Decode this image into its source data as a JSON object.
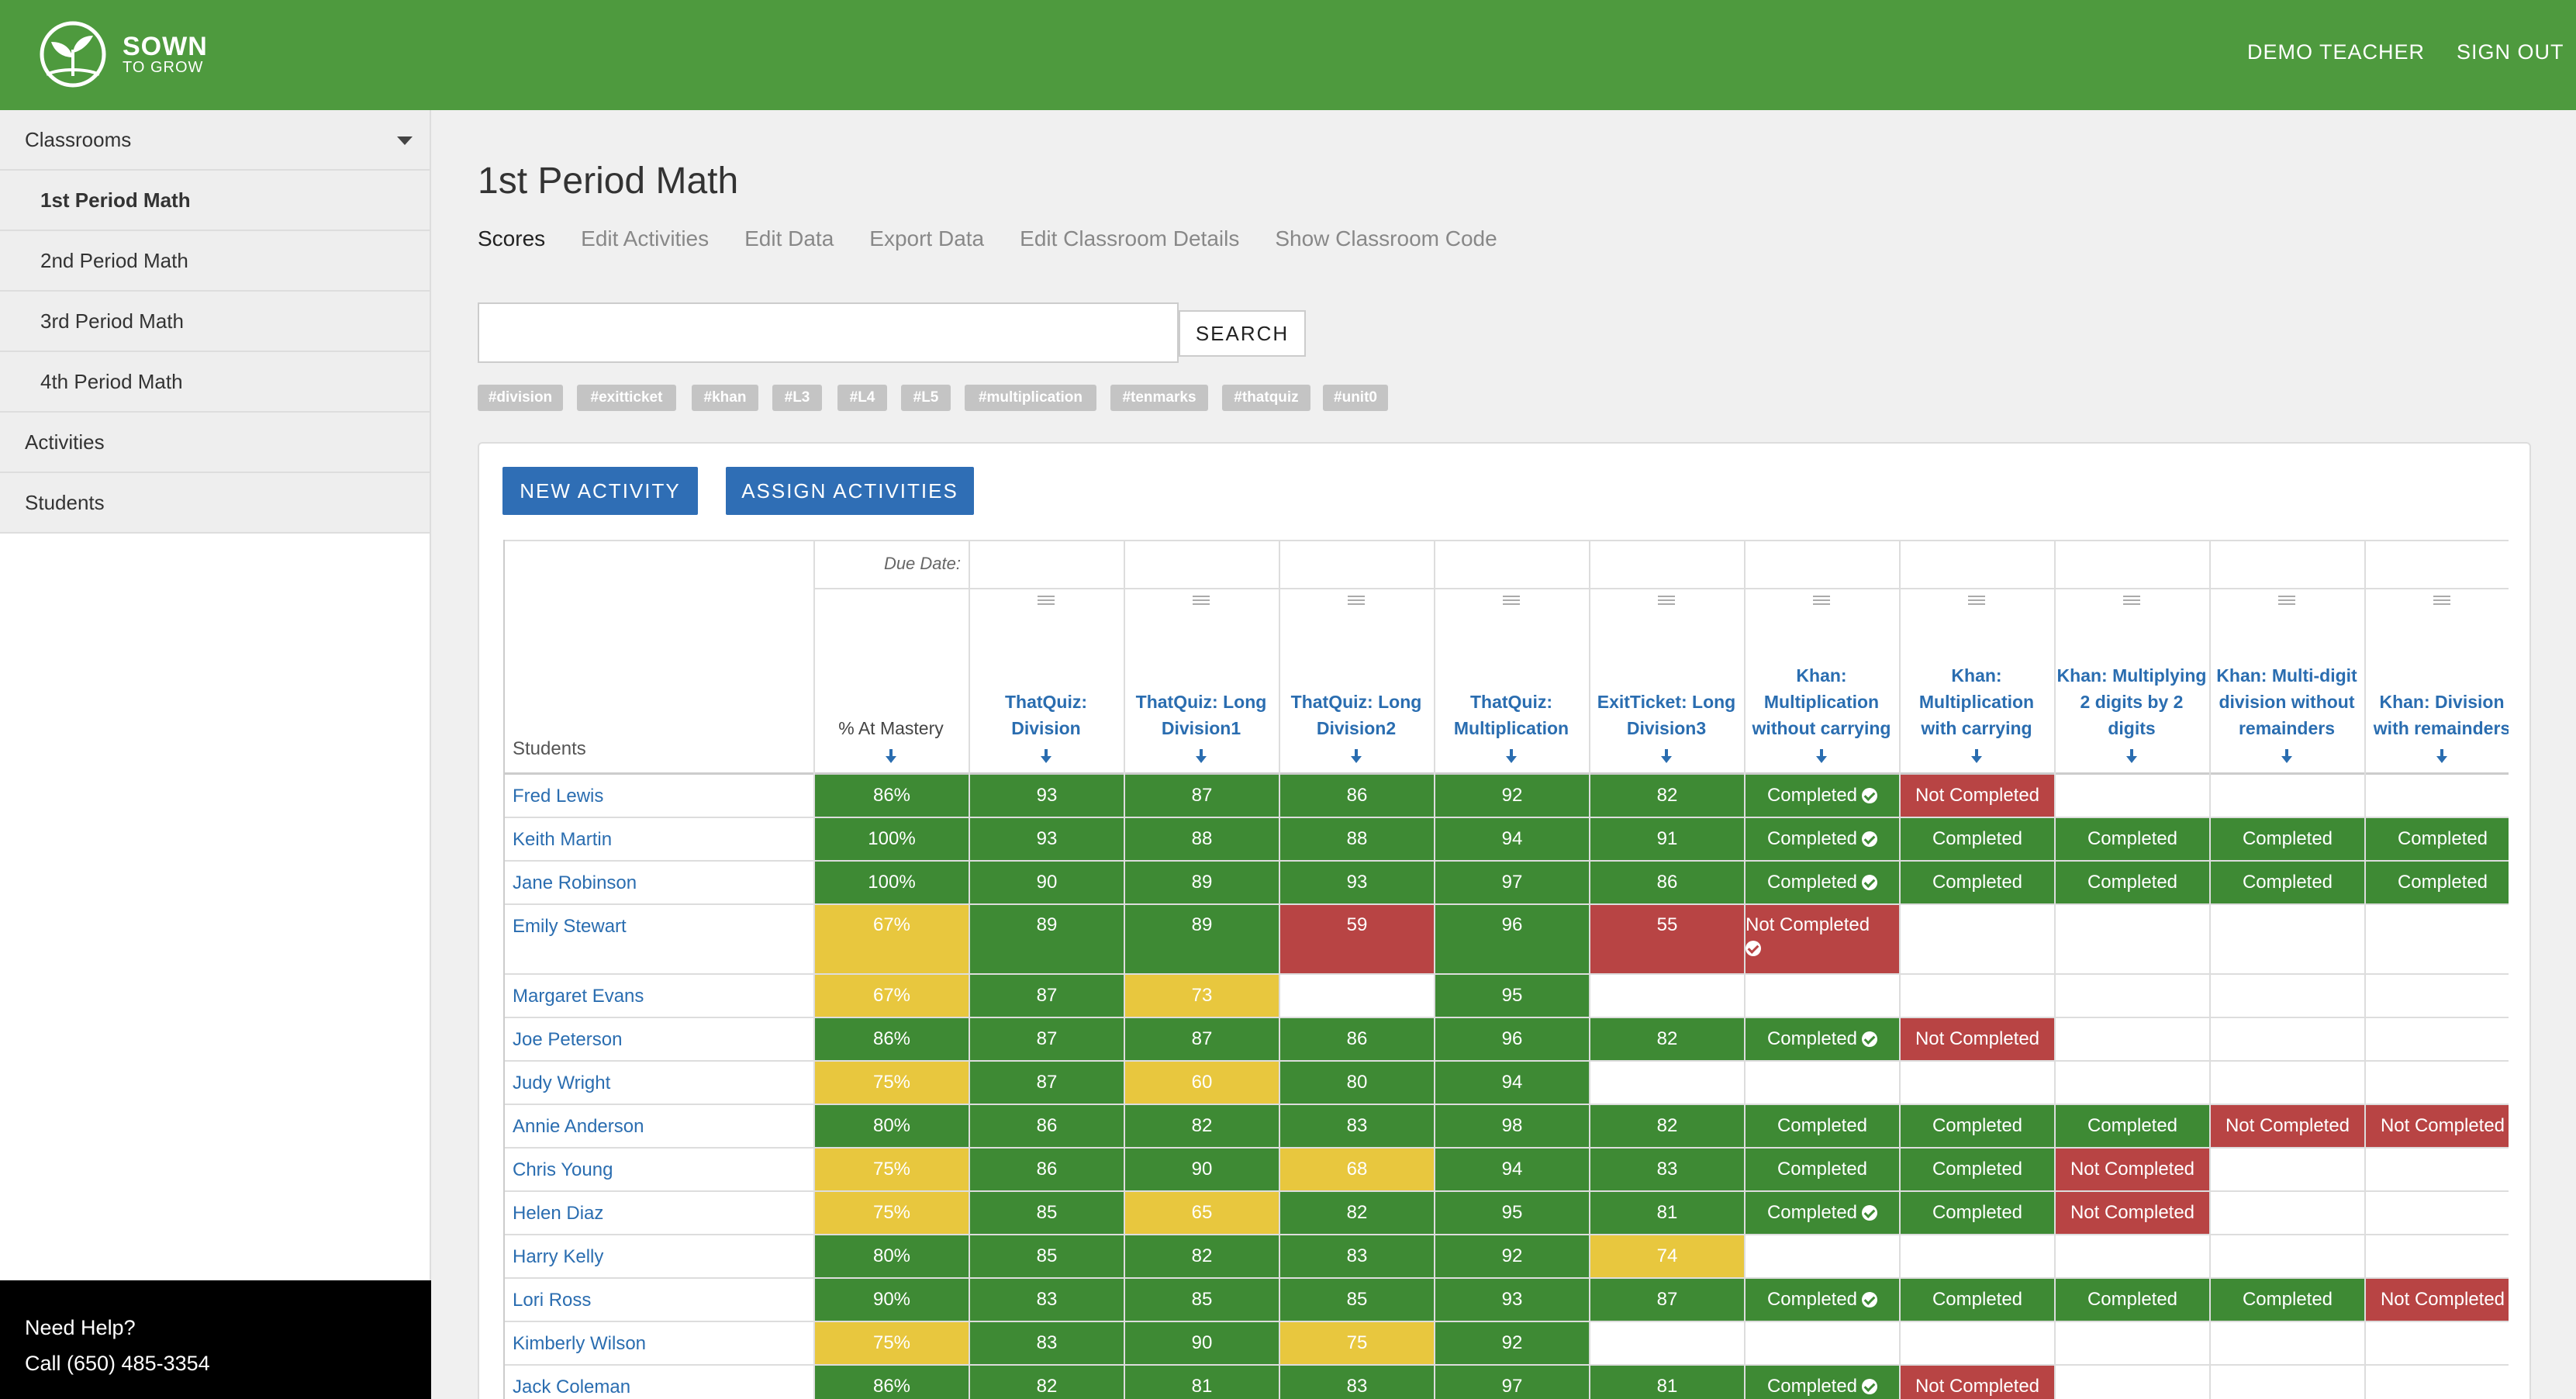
{
  "header": {
    "brand_line1": "SOWN",
    "brand_line2": "TO GROW",
    "user_label": "DEMO TEACHER",
    "signout_label": "SIGN OUT",
    "color": "#4e9a3e"
  },
  "sidebar": {
    "items": [
      {
        "label": "Classrooms",
        "level": "top",
        "expandable": true
      },
      {
        "label": "1st Period Math",
        "level": "sub",
        "selected": true
      },
      {
        "label": "2nd Period Math",
        "level": "sub"
      },
      {
        "label": "3rd Period Math",
        "level": "sub"
      },
      {
        "label": "4th Period Math",
        "level": "sub"
      },
      {
        "label": "Activities",
        "level": "top"
      },
      {
        "label": "Students",
        "level": "top"
      }
    ],
    "help_title": "Need Help?",
    "help_phone": "Call (650) 485-3354"
  },
  "main": {
    "title": "1st Period Math",
    "tabs": [
      "Scores",
      "Edit Activities",
      "Edit Data",
      "Export Data",
      "Edit Classroom Details",
      "Show Classroom Code"
    ],
    "active_tab": "Scores",
    "search": {
      "value": "",
      "placeholder": "",
      "button_label": "SEARCH"
    },
    "tags": [
      "#division",
      "#exitticket",
      "#khan",
      "#L3",
      "#L4",
      "#L5",
      "#multiplication",
      "#tenmarks",
      "#thatquiz",
      "#unit0"
    ],
    "new_activity_label": "NEW ACTIVITY",
    "assign_activities_label": "ASSIGN ACTIVITIES"
  },
  "table": {
    "due_date_label": "Due Date:",
    "students_header": "Students",
    "mastery_header": "% At Mastery",
    "columns": [
      "ThatQuiz: Division",
      "ThatQuiz: Long Division1",
      "ThatQuiz: Long Division2",
      "ThatQuiz: Multiplication",
      "ExitTicket: Long Division3",
      "Khan: Multiplication without carrying",
      "Khan: Multiplication with carrying",
      "Khan: Multiplying 2 digits by 2 digits",
      "Khan: Multi-digit division without remainders",
      "Khan: Division with remainders"
    ],
    "status_colors": {
      "green": "#3e8a34",
      "yellow": "#e8c73e",
      "red": "#b84444"
    },
    "rows": [
      {
        "name": "Fred Lewis",
        "mastery": {
          "v": "86%",
          "c": "g"
        },
        "cells": [
          {
            "v": "93",
            "c": "g"
          },
          {
            "v": "87",
            "c": "g"
          },
          {
            "v": "86",
            "c": "g"
          },
          {
            "v": "92",
            "c": "g"
          },
          {
            "v": "82",
            "c": "g"
          },
          {
            "v": "Completed",
            "c": "g",
            "check": true
          },
          {
            "v": "Not Completed",
            "c": "r"
          },
          {
            "v": "",
            "c": ""
          },
          {
            "v": "",
            "c": ""
          },
          {
            "v": "",
            "c": ""
          }
        ]
      },
      {
        "name": "Keith Martin",
        "mastery": {
          "v": "100%",
          "c": "g"
        },
        "cells": [
          {
            "v": "93",
            "c": "g"
          },
          {
            "v": "88",
            "c": "g"
          },
          {
            "v": "88",
            "c": "g"
          },
          {
            "v": "94",
            "c": "g"
          },
          {
            "v": "91",
            "c": "g"
          },
          {
            "v": "Completed",
            "c": "g",
            "check": true
          },
          {
            "v": "Completed",
            "c": "g"
          },
          {
            "v": "Completed",
            "c": "g"
          },
          {
            "v": "Completed",
            "c": "g"
          },
          {
            "v": "Completed",
            "c": "g"
          }
        ]
      },
      {
        "name": "Jane Robinson",
        "mastery": {
          "v": "100%",
          "c": "g"
        },
        "cells": [
          {
            "v": "90",
            "c": "g"
          },
          {
            "v": "89",
            "c": "g"
          },
          {
            "v": "93",
            "c": "g"
          },
          {
            "v": "97",
            "c": "g"
          },
          {
            "v": "86",
            "c": "g"
          },
          {
            "v": "Completed",
            "c": "g",
            "check": true
          },
          {
            "v": "Completed",
            "c": "g"
          },
          {
            "v": "Completed",
            "c": "g"
          },
          {
            "v": "Completed",
            "c": "g"
          },
          {
            "v": "Completed",
            "c": "g"
          }
        ]
      },
      {
        "name": "Emily Stewart",
        "mastery": {
          "v": "67%",
          "c": "y"
        },
        "tall": true,
        "cells": [
          {
            "v": "89",
            "c": "g"
          },
          {
            "v": "89",
            "c": "g"
          },
          {
            "v": "59",
            "c": "r"
          },
          {
            "v": "96",
            "c": "g"
          },
          {
            "v": "55",
            "c": "r"
          },
          {
            "v": "Not Completed",
            "c": "r",
            "check": true,
            "wrap": true
          },
          {
            "v": "",
            "c": ""
          },
          {
            "v": "",
            "c": ""
          },
          {
            "v": "",
            "c": ""
          },
          {
            "v": "",
            "c": ""
          }
        ]
      },
      {
        "name": "Margaret Evans",
        "mastery": {
          "v": "67%",
          "c": "y"
        },
        "cells": [
          {
            "v": "87",
            "c": "g"
          },
          {
            "v": "73",
            "c": "y"
          },
          {
            "v": "",
            "c": ""
          },
          {
            "v": "95",
            "c": "g"
          },
          {
            "v": "",
            "c": ""
          },
          {
            "v": "",
            "c": ""
          },
          {
            "v": "",
            "c": ""
          },
          {
            "v": "",
            "c": ""
          },
          {
            "v": "",
            "c": ""
          },
          {
            "v": "",
            "c": ""
          }
        ]
      },
      {
        "name": "Joe Peterson",
        "mastery": {
          "v": "86%",
          "c": "g"
        },
        "cells": [
          {
            "v": "87",
            "c": "g"
          },
          {
            "v": "87",
            "c": "g"
          },
          {
            "v": "86",
            "c": "g"
          },
          {
            "v": "96",
            "c": "g"
          },
          {
            "v": "82",
            "c": "g"
          },
          {
            "v": "Completed",
            "c": "g",
            "check": true
          },
          {
            "v": "Not Completed",
            "c": "r"
          },
          {
            "v": "",
            "c": ""
          },
          {
            "v": "",
            "c": ""
          },
          {
            "v": "",
            "c": ""
          }
        ]
      },
      {
        "name": "Judy Wright",
        "mastery": {
          "v": "75%",
          "c": "y"
        },
        "cells": [
          {
            "v": "87",
            "c": "g"
          },
          {
            "v": "60",
            "c": "y"
          },
          {
            "v": "80",
            "c": "g"
          },
          {
            "v": "94",
            "c": "g"
          },
          {
            "v": "",
            "c": ""
          },
          {
            "v": "",
            "c": ""
          },
          {
            "v": "",
            "c": ""
          },
          {
            "v": "",
            "c": ""
          },
          {
            "v": "",
            "c": ""
          },
          {
            "v": "",
            "c": ""
          }
        ]
      },
      {
        "name": "Annie Anderson",
        "mastery": {
          "v": "80%",
          "c": "g"
        },
        "cells": [
          {
            "v": "86",
            "c": "g"
          },
          {
            "v": "82",
            "c": "g"
          },
          {
            "v": "83",
            "c": "g"
          },
          {
            "v": "98",
            "c": "g"
          },
          {
            "v": "82",
            "c": "g"
          },
          {
            "v": "Completed",
            "c": "g"
          },
          {
            "v": "Completed",
            "c": "g"
          },
          {
            "v": "Completed",
            "c": "g"
          },
          {
            "v": "Not Completed",
            "c": "r"
          },
          {
            "v": "Not Completed",
            "c": "r"
          }
        ]
      },
      {
        "name": "Chris Young",
        "mastery": {
          "v": "75%",
          "c": "y"
        },
        "cells": [
          {
            "v": "86",
            "c": "g"
          },
          {
            "v": "90",
            "c": "g"
          },
          {
            "v": "68",
            "c": "y"
          },
          {
            "v": "94",
            "c": "g"
          },
          {
            "v": "83",
            "c": "g"
          },
          {
            "v": "Completed",
            "c": "g"
          },
          {
            "v": "Completed",
            "c": "g"
          },
          {
            "v": "Not Completed",
            "c": "r"
          },
          {
            "v": "",
            "c": ""
          },
          {
            "v": "",
            "c": ""
          }
        ]
      },
      {
        "name": "Helen Diaz",
        "mastery": {
          "v": "75%",
          "c": "y"
        },
        "cells": [
          {
            "v": "85",
            "c": "g"
          },
          {
            "v": "65",
            "c": "y"
          },
          {
            "v": "82",
            "c": "g"
          },
          {
            "v": "95",
            "c": "g"
          },
          {
            "v": "81",
            "c": "g"
          },
          {
            "v": "Completed",
            "c": "g",
            "check": true
          },
          {
            "v": "Completed",
            "c": "g"
          },
          {
            "v": "Not Completed",
            "c": "r"
          },
          {
            "v": "",
            "c": ""
          },
          {
            "v": "",
            "c": ""
          }
        ]
      },
      {
        "name": "Harry Kelly",
        "mastery": {
          "v": "80%",
          "c": "g"
        },
        "cells": [
          {
            "v": "85",
            "c": "g"
          },
          {
            "v": "82",
            "c": "g"
          },
          {
            "v": "83",
            "c": "g"
          },
          {
            "v": "92",
            "c": "g"
          },
          {
            "v": "74",
            "c": "y"
          },
          {
            "v": "",
            "c": ""
          },
          {
            "v": "",
            "c": ""
          },
          {
            "v": "",
            "c": ""
          },
          {
            "v": "",
            "c": ""
          },
          {
            "v": "",
            "c": ""
          }
        ]
      },
      {
        "name": "Lori Ross",
        "mastery": {
          "v": "90%",
          "c": "g"
        },
        "cells": [
          {
            "v": "83",
            "c": "g"
          },
          {
            "v": "85",
            "c": "g"
          },
          {
            "v": "85",
            "c": "g"
          },
          {
            "v": "93",
            "c": "g"
          },
          {
            "v": "87",
            "c": "g"
          },
          {
            "v": "Completed",
            "c": "g",
            "check": true
          },
          {
            "v": "Completed",
            "c": "g"
          },
          {
            "v": "Completed",
            "c": "g"
          },
          {
            "v": "Completed",
            "c": "g"
          },
          {
            "v": "Not Completed",
            "c": "r"
          }
        ]
      },
      {
        "name": "Kimberly Wilson",
        "mastery": {
          "v": "75%",
          "c": "y"
        },
        "cells": [
          {
            "v": "83",
            "c": "g"
          },
          {
            "v": "90",
            "c": "g"
          },
          {
            "v": "75",
            "c": "y"
          },
          {
            "v": "92",
            "c": "g"
          },
          {
            "v": "",
            "c": ""
          },
          {
            "v": "",
            "c": ""
          },
          {
            "v": "",
            "c": ""
          },
          {
            "v": "",
            "c": ""
          },
          {
            "v": "",
            "c": ""
          },
          {
            "v": "",
            "c": ""
          }
        ]
      },
      {
        "name": "Jack Coleman",
        "mastery": {
          "v": "86%",
          "c": "g"
        },
        "cells": [
          {
            "v": "82",
            "c": "g"
          },
          {
            "v": "81",
            "c": "g"
          },
          {
            "v": "83",
            "c": "g"
          },
          {
            "v": "97",
            "c": "g"
          },
          {
            "v": "81",
            "c": "g"
          },
          {
            "v": "Completed",
            "c": "g",
            "check": true
          },
          {
            "v": "Not Completed",
            "c": "r"
          },
          {
            "v": "",
            "c": ""
          },
          {
            "v": "",
            "c": ""
          },
          {
            "v": "",
            "c": ""
          }
        ]
      }
    ]
  }
}
